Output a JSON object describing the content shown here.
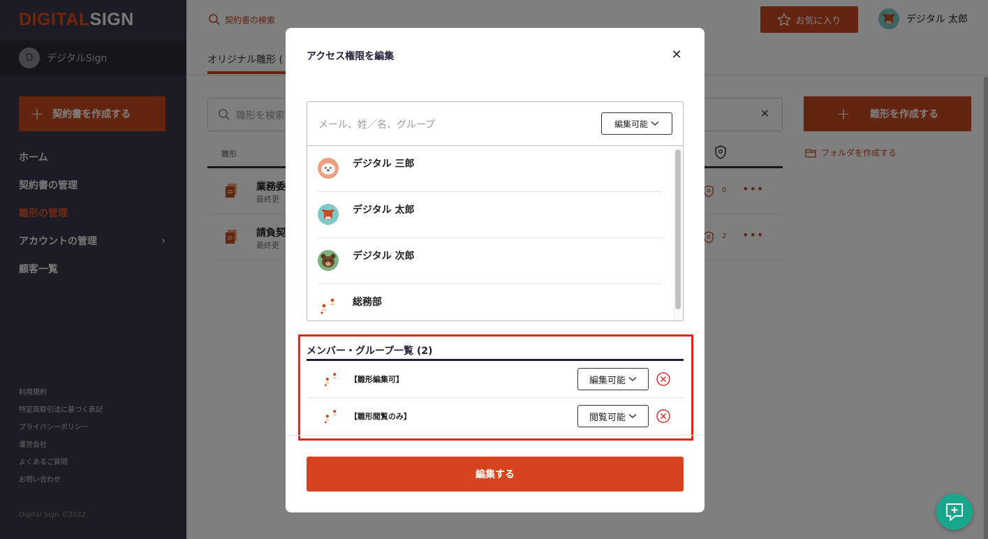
{
  "brand": {
    "logo_part1": "DIGITAL",
    "logo_part2": "SIGN"
  },
  "workspace": {
    "initial": "D",
    "name": "デジタルSign"
  },
  "sidebar": {
    "create_contract": "契約書を作成する",
    "nav": [
      {
        "label": "ホーム"
      },
      {
        "label": "契約書の管理"
      },
      {
        "label": "雛形の管理"
      },
      {
        "label": "アカウントの管理"
      },
      {
        "label": "顧客一覧"
      }
    ],
    "footer_links": [
      "利用規約",
      "特定商取引法に基づく表記",
      "プライバシーポリシー",
      "運営会社",
      "よくあるご質問",
      "お問い合わせ"
    ],
    "copyright": "Digital Sign ©2022"
  },
  "header": {
    "search_contracts": "契約書の検索",
    "favorites": "お気に入り",
    "user_name": "デジタル 太郎"
  },
  "main": {
    "tab_original": "オリジナル雛形 (",
    "search_placeholder": "雛形を検索",
    "create_template": "雛形を作成する",
    "create_folder": "フォルダを作成する",
    "col_name": "雛形",
    "rows": [
      {
        "title": "業務委",
        "sub": "最終更",
        "count": "0"
      },
      {
        "title": "請負契",
        "sub": "最終更",
        "count": "2"
      }
    ]
  },
  "modal": {
    "title": "アクセス権限を編集",
    "search_placeholder": "メール、姓／名、グループ",
    "permission_default": "編集可能",
    "candidates": [
      {
        "name": "デジタル 三郎",
        "avatar": "seal-avatar-icon"
      },
      {
        "name": "デジタル 太郎",
        "avatar": "bull-avatar-icon"
      },
      {
        "name": "デジタル 次郎",
        "avatar": "bear-avatar-icon"
      },
      {
        "name": "総務部",
        "avatar": "group-icon"
      }
    ],
    "members_heading": "メンバー・グループ一覧 (2)",
    "members": [
      {
        "name": "【雛形編集可】",
        "permission": "編集可能"
      },
      {
        "name": "【雛形閲覧のみ】",
        "permission": "閲覧可能"
      }
    ],
    "submit": "編集する"
  },
  "colors": {
    "accent": "#c94b21",
    "sidebar": "#3a3747",
    "highlight": "#e5241b",
    "chat": "#18a68c"
  }
}
